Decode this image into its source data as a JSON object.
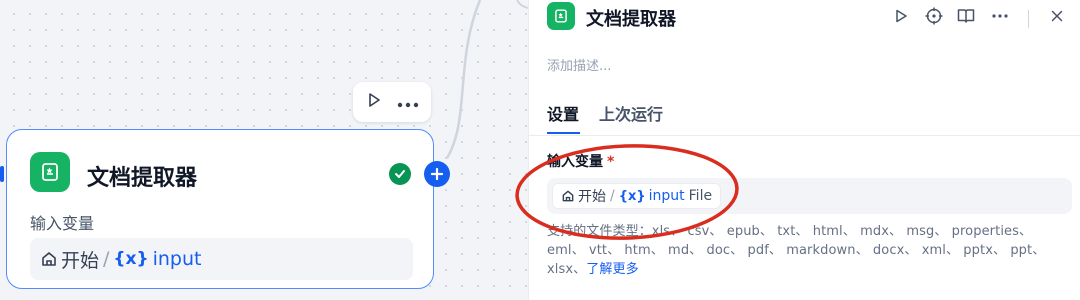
{
  "canvas": {
    "node": {
      "title": "文档提取器",
      "input_label": "输入变量",
      "var": {
        "source": "开始",
        "separator": "/",
        "name": "input"
      }
    }
  },
  "panel": {
    "title": "文档提取器",
    "description_placeholder": "添加描述...",
    "tabs": [
      {
        "label": "设置",
        "active": true
      },
      {
        "label": "上次运行",
        "active": false
      }
    ],
    "field": {
      "label": "输入变量",
      "required_mark": "*",
      "chip": {
        "source": "开始",
        "separator": "/",
        "name": "input",
        "type": "File"
      }
    },
    "supported_text": "支持的文件类型：xls、 csv、 epub、 txt、 html、 mdx、 msg、 properties、 eml、 vtt、 htm、 md、 doc、 pdf、 markdown、 docx、 xml、 pptx、 ppt、 xlsx、",
    "learn_more": "了解更多"
  },
  "colors": {
    "accent": "#155eef",
    "node_icon": "#16b364",
    "success": "#079455",
    "annotation": "#d92d20"
  },
  "icons": [
    "play-icon",
    "more-icon",
    "document-icon",
    "check-icon",
    "plus-icon",
    "locate-icon",
    "book-icon",
    "close-icon",
    "home-icon",
    "variable-icon"
  ]
}
